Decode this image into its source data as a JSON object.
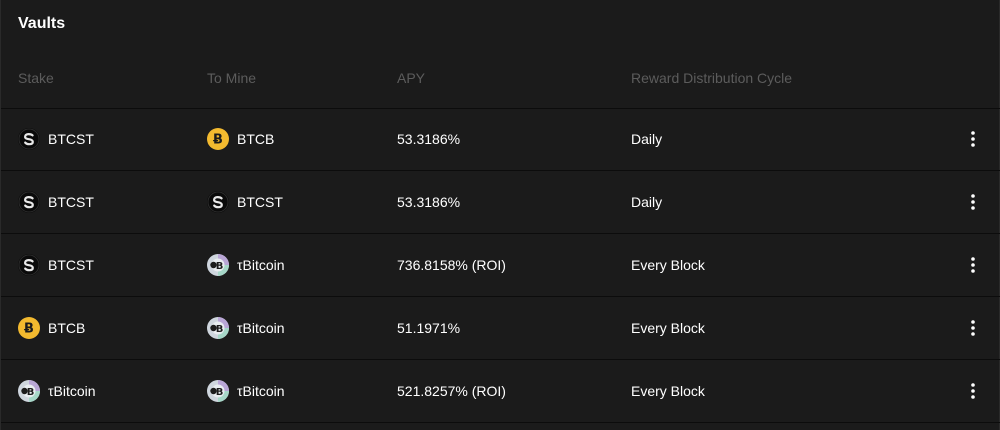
{
  "title": "Vaults",
  "columns": {
    "stake": "Stake",
    "to_mine": "To Mine",
    "apy": "APY",
    "cycle": "Reward Distribution Cycle"
  },
  "rows": [
    {
      "stake": {
        "label": "BTCST",
        "icon": "btcst-icon"
      },
      "mine": {
        "label": "BTCB",
        "icon": "btcb-icon"
      },
      "apy": "53.3186%",
      "cycle": "Daily"
    },
    {
      "stake": {
        "label": "BTCST",
        "icon": "btcst-icon"
      },
      "mine": {
        "label": "BTCST",
        "icon": "btcst-icon"
      },
      "apy": "53.3186%",
      "cycle": "Daily"
    },
    {
      "stake": {
        "label": "BTCST",
        "icon": "btcst-icon"
      },
      "mine": {
        "label": "τBitcoin",
        "icon": "tbitcoin-icon"
      },
      "apy": "736.8158% (ROI)",
      "cycle": "Every Block"
    },
    {
      "stake": {
        "label": "BTCB",
        "icon": "btcb-icon"
      },
      "mine": {
        "label": "τBitcoin",
        "icon": "tbitcoin-icon"
      },
      "apy": "51.1971%",
      "cycle": "Every Block"
    },
    {
      "stake": {
        "label": "τBitcoin",
        "icon": "tbitcoin-icon"
      },
      "mine": {
        "label": "τBitcoin",
        "icon": "tbitcoin-icon"
      },
      "apy": "521.8257% (ROI)",
      "cycle": "Every Block"
    }
  ],
  "colors": {
    "background": "#1b1b1b",
    "divider": "#0c0c0c",
    "header_text": "#5c5c5c",
    "text": "#ffffff",
    "btcb_gold": "#f3ba2f",
    "btcst_black": "#0a0a0a"
  }
}
